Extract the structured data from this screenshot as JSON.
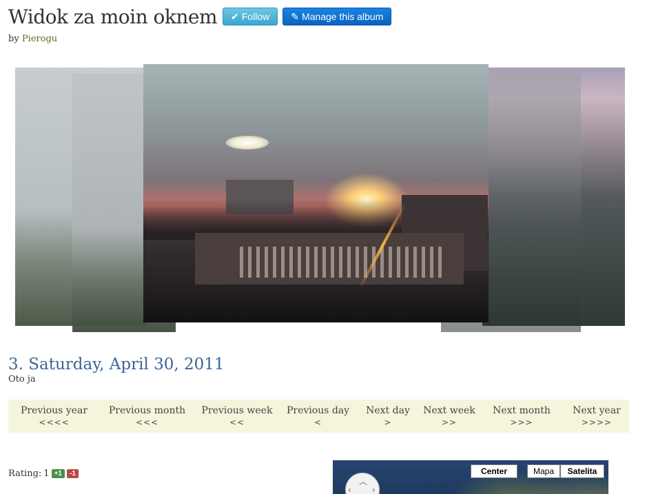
{
  "album": {
    "title": "Widok za moin oknem",
    "follow_label": "Follow",
    "manage_label": "Manage this album",
    "by_prefix": "by",
    "author": "Pierogu"
  },
  "entry": {
    "date_title": "3. Saturday, April 30, 2011",
    "caption": "Oto ja"
  },
  "nav": [
    {
      "label": "Previous year",
      "arrows": "<<<<"
    },
    {
      "label": "Previous month",
      "arrows": "<<<"
    },
    {
      "label": "Previous week",
      "arrows": "<<"
    },
    {
      "label": "Previous day",
      "arrows": "<"
    },
    {
      "label": "Next day",
      "arrows": ">"
    },
    {
      "label": "Next week",
      "arrows": ">>"
    },
    {
      "label": "Next month",
      "arrows": ">>>"
    },
    {
      "label": "Next year",
      "arrows": ">>>>"
    }
  ],
  "rating": {
    "label": "Rating:",
    "value": "1",
    "plus": "+1",
    "minus": "-1"
  },
  "map": {
    "center_label": "Center",
    "mapa_label": "Mapa",
    "satelita_label": "Satelita"
  },
  "colors": {
    "follow_btn": "#3aa6cf",
    "manage_btn": "#0a63c2",
    "date_title": "#3c6496",
    "nav_bg": "#f5f5dc",
    "plus_badge": "#4d8c4b",
    "minus_badge": "#b94a48"
  }
}
